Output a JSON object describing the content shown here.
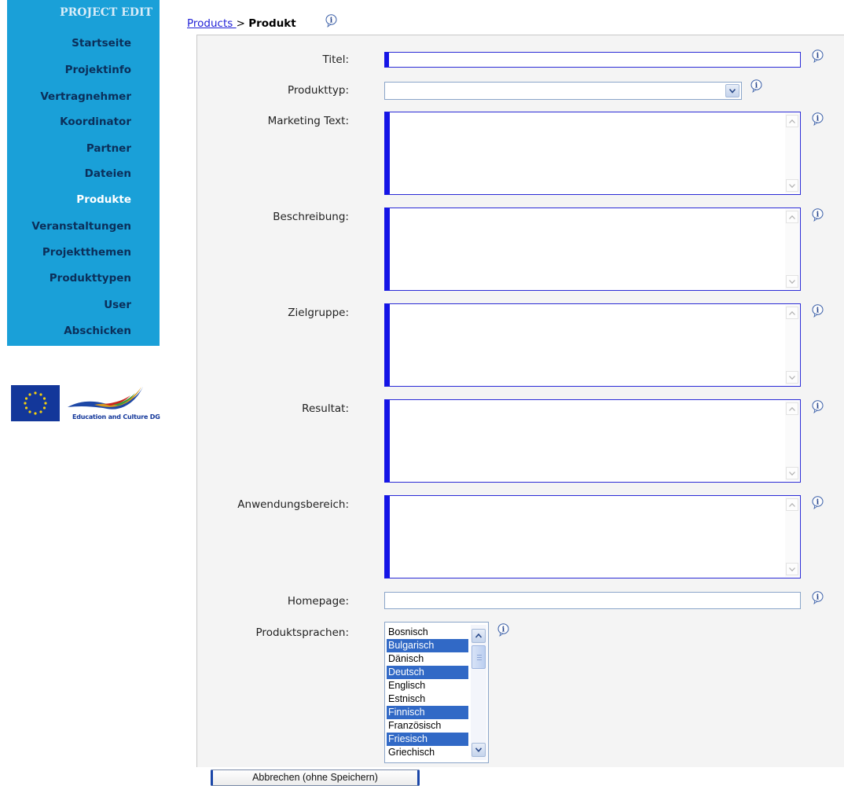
{
  "sidebar": {
    "title": "PROJECT EDIT",
    "items": [
      {
        "label": "Startseite"
      },
      {
        "label": "Projektinfo"
      },
      {
        "label": "Vertragnehmer"
      },
      {
        "label": "Koordinator"
      },
      {
        "label": "Partner"
      },
      {
        "label": "Dateien"
      },
      {
        "label": "Produkte",
        "active": true
      },
      {
        "label": "Veranstaltungen"
      },
      {
        "label": "Projektthemen"
      },
      {
        "label": "Produkttypen"
      },
      {
        "label": "User"
      },
      {
        "label": "Abschicken"
      }
    ],
    "logo_caption": "Education and Culture DG"
  },
  "breadcrumb": {
    "link": "Products ",
    "separator": ">",
    "current": "Produkt"
  },
  "form": {
    "titel_label": "Titel:",
    "titel_value": "",
    "produkttyp_label": "Produkttyp:",
    "produkttyp_value": "",
    "marketing_label": "Marketing Text:",
    "beschreibung_label": "Beschreibung:",
    "zielgruppe_label": "Zielgruppe:",
    "resultat_label": "Resultat:",
    "anwendungsbereich_label": "Anwendungsbereich:",
    "homepage_label": "Homepage:",
    "homepage_value": "",
    "sprachen_label": "Produktsprachen:",
    "sprachen_options": [
      {
        "label": "Bosnisch",
        "selected": false
      },
      {
        "label": "Bulgarisch",
        "selected": true
      },
      {
        "label": "Dänisch",
        "selected": false
      },
      {
        "label": "Deutsch",
        "selected": true
      },
      {
        "label": "Englisch",
        "selected": false
      },
      {
        "label": "Estnisch",
        "selected": false
      },
      {
        "label": "Finnisch",
        "selected": true
      },
      {
        "label": "Französisch",
        "selected": false
      },
      {
        "label": "Friesisch",
        "selected": true
      },
      {
        "label": "Griechisch",
        "selected": false
      }
    ]
  },
  "buttons": {
    "cancel": "Abbrechen (ohne Speichern)"
  },
  "colors": {
    "sidebar_bg": "#1aa0d8",
    "sidebar_text": "#0b2f5a",
    "required_border": "#1414e6",
    "selection": "#3169c6"
  }
}
